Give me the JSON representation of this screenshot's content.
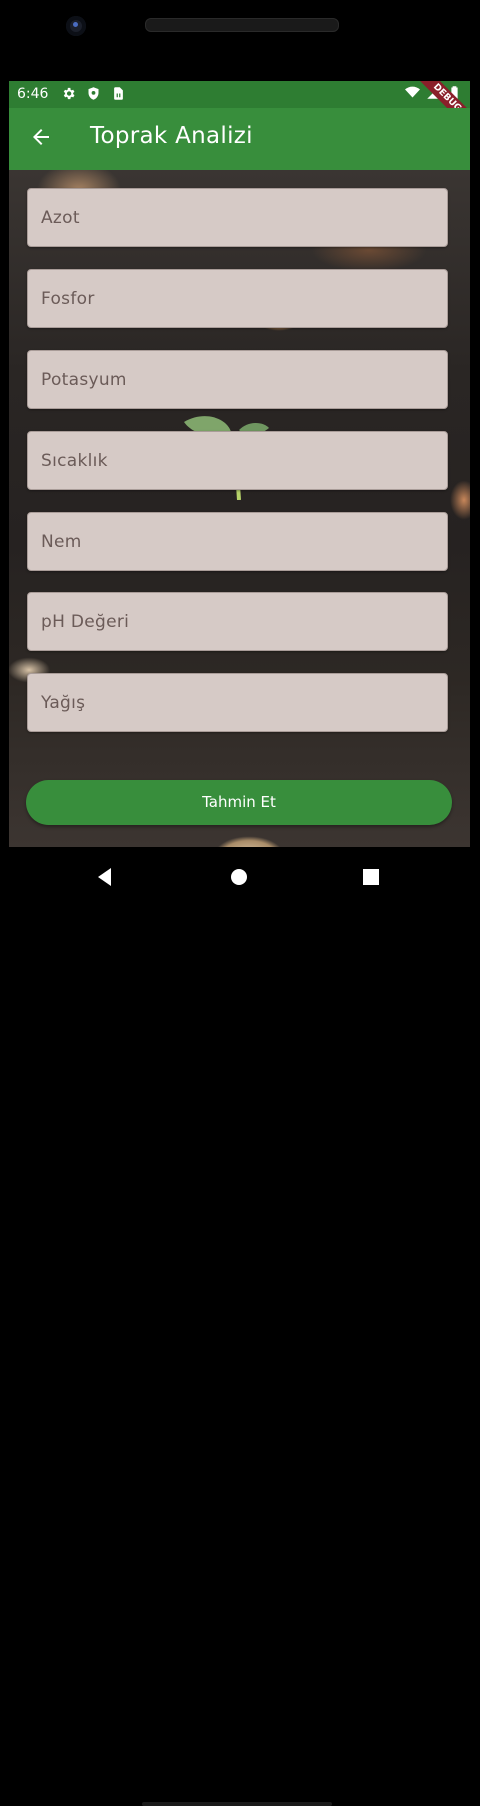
{
  "status_bar": {
    "time": "6:46",
    "left_icons": [
      "settings-icon",
      "shield-icon",
      "sim-card-icon"
    ],
    "right_icons": [
      "wifi-icon",
      "signal-icon",
      "battery-icon"
    ],
    "debug_label": "DEBUG"
  },
  "app_bar": {
    "title": "Toprak Analizi",
    "back_icon": "arrow-left-icon",
    "color": "#388e3c"
  },
  "form": {
    "fields": [
      {
        "label": "Azot"
      },
      {
        "label": "Fosfor"
      },
      {
        "label": "Potasyum"
      },
      {
        "label": "Sıcaklık"
      },
      {
        "label": "Nem"
      },
      {
        "label": "pH Değeri"
      },
      {
        "label": "Yağış"
      }
    ],
    "submit_label": "Tahmin Et"
  },
  "nav_bar": {
    "buttons": [
      "back-triangle-icon",
      "home-circle-icon",
      "recents-square-icon"
    ]
  }
}
